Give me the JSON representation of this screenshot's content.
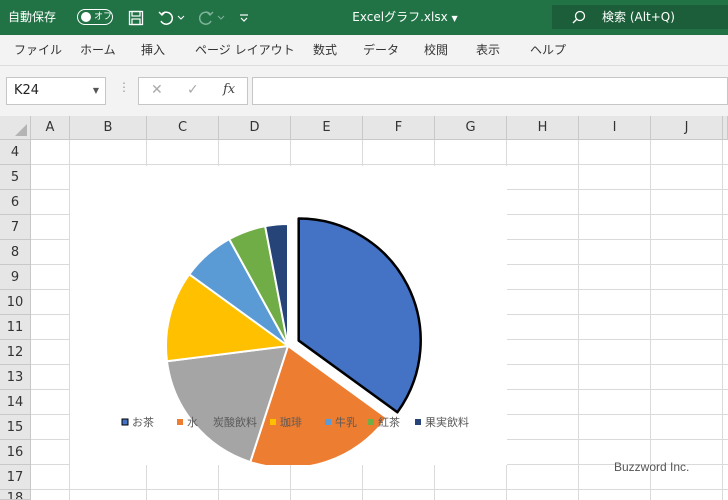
{
  "titlebar": {
    "autosave_label": "自動保存",
    "autosave_state": "オフ",
    "filename": "Excelグラフ.xlsx",
    "search_placeholder": "検索 (Alt+Q)"
  },
  "ribbon": {
    "tabs": [
      "ファイル",
      "ホーム",
      "挿入",
      "ページ レイアウト",
      "数式",
      "データ",
      "校閲",
      "表示",
      "ヘルプ"
    ]
  },
  "formula_bar": {
    "name_box": "K24",
    "fx_label": "fx",
    "formula": ""
  },
  "grid": {
    "columns": [
      "A",
      "B",
      "C",
      "D",
      "E",
      "F",
      "G",
      "H",
      "I",
      "J"
    ],
    "rows": [
      "4",
      "5",
      "6",
      "7",
      "8",
      "9",
      "10",
      "11",
      "12",
      "13",
      "14",
      "15",
      "16",
      "17",
      "18"
    ]
  },
  "chart_data": {
    "type": "pie",
    "categories": [
      "お茶",
      "水",
      "炭酸飲料",
      "珈琲",
      "牛乳",
      "紅茶",
      "果実飲料"
    ],
    "values": [
      35,
      20,
      18,
      12,
      7,
      5,
      3
    ],
    "colors": [
      "#4472C4",
      "#ED7D31",
      "#A5A5A5",
      "#FFC000",
      "#5B9BD5",
      "#70AD47",
      "#264478"
    ],
    "exploded_slice": "お茶",
    "legend_position": "bottom"
  },
  "watermark": "Buzzword Inc."
}
